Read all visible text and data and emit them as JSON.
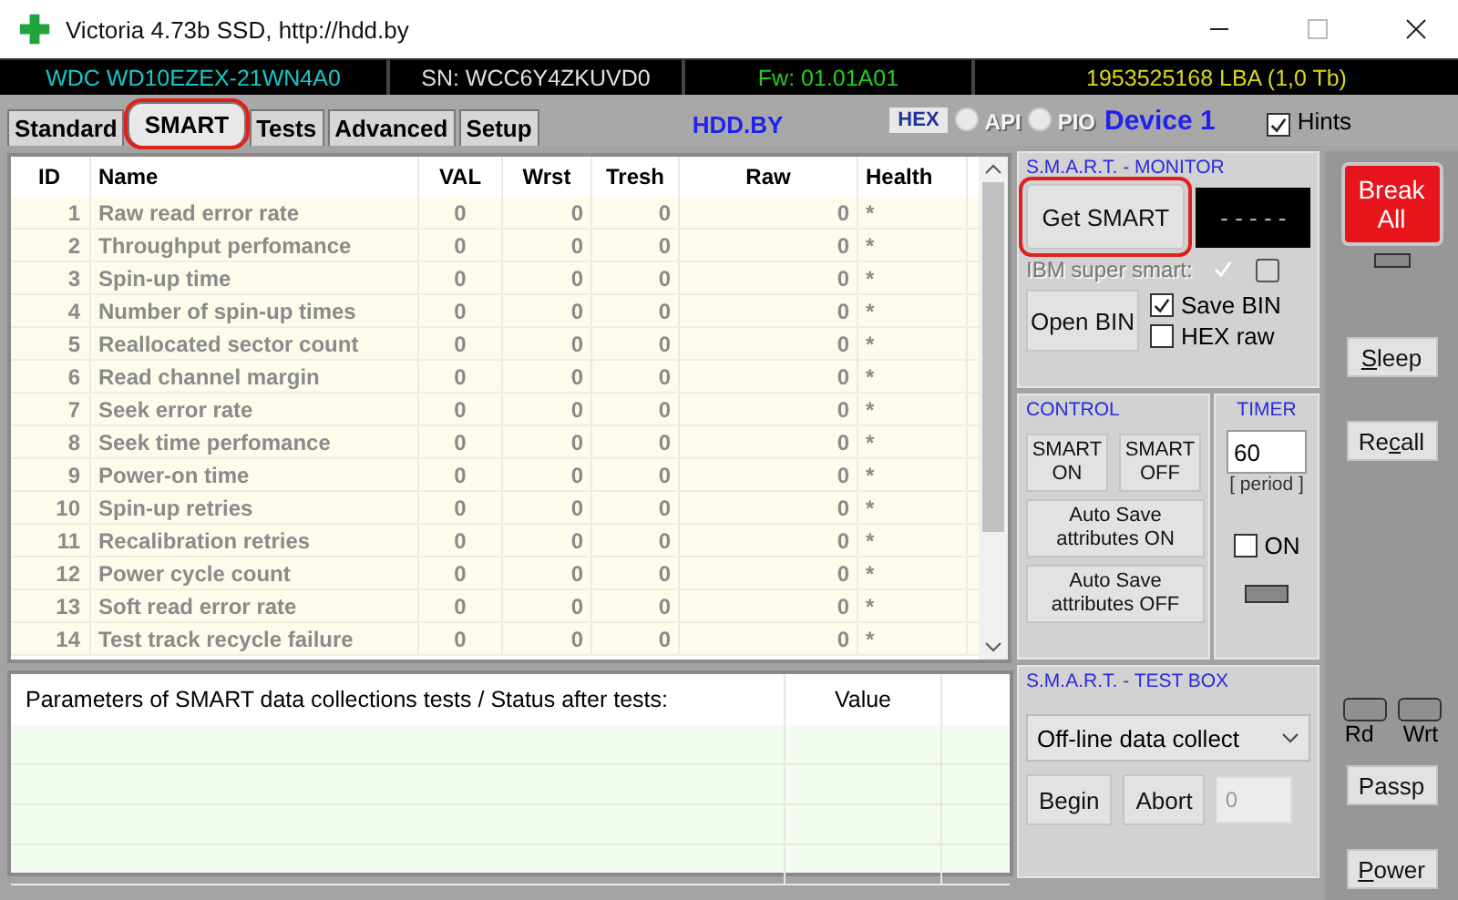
{
  "window": {
    "title": "Victoria 4.73b SSD, http://hdd.by"
  },
  "info_bar": [
    "WDC WD10EZEX-21WN4A0",
    "SN: WCC6Y4ZKUVD0",
    "Fw: 01.01A01",
    "1953525168 LBA (1,0 Tb)"
  ],
  "tabs": [
    {
      "label": "Standard",
      "selected": false,
      "highlighted": false
    },
    {
      "label": "SMART",
      "selected": true,
      "highlighted": true
    },
    {
      "label": "Tests",
      "selected": false,
      "highlighted": false
    },
    {
      "label": "Advanced",
      "selected": false,
      "highlighted": false
    },
    {
      "label": "Setup",
      "selected": false,
      "highlighted": false
    }
  ],
  "site_link": "HDD.BY",
  "hex_button": "HEX",
  "modes": [
    {
      "label": "API",
      "selected": false
    },
    {
      "label": "PIO",
      "selected": false
    }
  ],
  "device": "Device 1",
  "hints": {
    "label": "Hints",
    "checked": true
  },
  "smart_table": {
    "columns": [
      "ID",
      "Name",
      "VAL",
      "Wrst",
      "Tresh",
      "Raw",
      "Health"
    ],
    "rows": [
      [
        "1",
        "Raw read error rate",
        "0",
        "0",
        "0",
        "0",
        "*"
      ],
      [
        "2",
        "Throughput perfomance",
        "0",
        "0",
        "0",
        "0",
        "*"
      ],
      [
        "3",
        "Spin-up time",
        "0",
        "0",
        "0",
        "0",
        "*"
      ],
      [
        "4",
        "Number of spin-up times",
        "0",
        "0",
        "0",
        "0",
        "*"
      ],
      [
        "5",
        "Reallocated sector count",
        "0",
        "0",
        "0",
        "0",
        "*"
      ],
      [
        "6",
        "Read channel margin",
        "0",
        "0",
        "0",
        "0",
        "*"
      ],
      [
        "7",
        "Seek error rate",
        "0",
        "0",
        "0",
        "0",
        "*"
      ],
      [
        "8",
        "Seek time perfomance",
        "0",
        "0",
        "0",
        "0",
        "*"
      ],
      [
        "9",
        "Power-on time",
        "0",
        "0",
        "0",
        "0",
        "*"
      ],
      [
        "10",
        "Spin-up retries",
        "0",
        "0",
        "0",
        "0",
        "*"
      ],
      [
        "11",
        "Recalibration retries",
        "0",
        "0",
        "0",
        "0",
        "*"
      ],
      [
        "12",
        "Power cycle count",
        "0",
        "0",
        "0",
        "0",
        "*"
      ],
      [
        "13",
        "Soft read error rate",
        "0",
        "0",
        "0",
        "0",
        "*"
      ],
      [
        "14",
        "Test track recycle failure",
        "0",
        "0",
        "0",
        "0",
        "*"
      ]
    ]
  },
  "test_table": {
    "columns": [
      "Parameters of SMART data collections tests / Status after tests:",
      "Value"
    ]
  },
  "monitor": {
    "title": "S.M.A.R.T. - MONITOR",
    "get_button": {
      "label": "Get SMART",
      "highlighted": true
    },
    "display": "- - - - -",
    "ibm": {
      "label": "IBM super smart:",
      "checked": true,
      "disabled": true
    },
    "extra_checked": false,
    "open_button": "Open BIN",
    "save_bin": {
      "label": "Save BIN",
      "checked": true
    },
    "hex_raw": {
      "label": "HEX raw",
      "checked": false
    }
  },
  "control": {
    "title": "CONTROL",
    "buttons": [
      "SMART ON",
      "SMART OFF",
      "Auto Save attributes ON",
      "Auto Save attributes OFF"
    ]
  },
  "timer": {
    "title": "TIMER",
    "value": "60",
    "caption": "[ period ]",
    "on": {
      "label": "ON",
      "checked": false
    }
  },
  "test_box": {
    "title": "S.M.A.R.T. - TEST BOX",
    "select": "Off-line data collect",
    "begin": "Begin",
    "abort": "Abort",
    "count": "0"
  },
  "side": {
    "break": "Break All",
    "buttons": [
      [
        {
          "text": "S",
          "underlined": true
        },
        {
          "text": "leep",
          "underlined": false
        }
      ],
      [
        {
          "text": "Re",
          "underlined": false
        },
        {
          "text": "c",
          "underlined": true
        },
        {
          "text": "all",
          "underlined": false
        }
      ]
    ],
    "rd": "Rd",
    "wrt": "Wrt",
    "lower": [
      [
        {
          "text": "Passp",
          "underlined": false
        }
      ],
      [
        {
          "text": "P",
          "underlined": true
        },
        {
          "text": "ower",
          "underlined": false
        }
      ]
    ]
  }
}
